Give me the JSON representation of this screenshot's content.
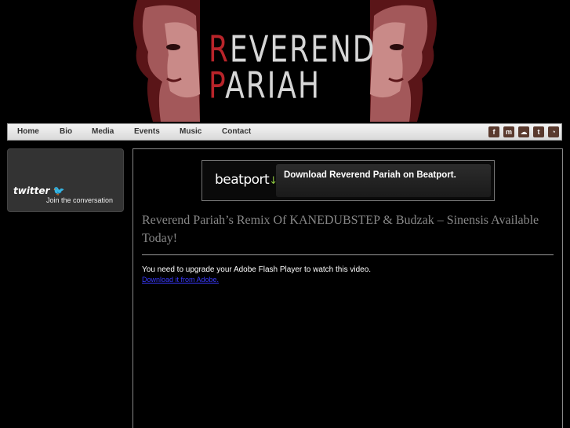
{
  "header": {
    "logo_line1_initial": "R",
    "logo_line1_rest": "EVEREND",
    "logo_line2_initial": "P",
    "logo_line2_rest": "ARIAH"
  },
  "nav": {
    "items": [
      {
        "label": "Home"
      },
      {
        "label": "Bio"
      },
      {
        "label": "Media"
      },
      {
        "label": "Events"
      },
      {
        "label": "Music"
      },
      {
        "label": "Contact"
      }
    ],
    "social": [
      {
        "name": "facebook-icon",
        "glyph": "f"
      },
      {
        "name": "myspace-icon",
        "glyph": "m"
      },
      {
        "name": "soundcloud-icon",
        "glyph": "☁"
      },
      {
        "name": "twitter-icon",
        "glyph": "t"
      },
      {
        "name": "rss-icon",
        "glyph": "◔"
      }
    ]
  },
  "sidebar": {
    "twitter_logo": "twitter",
    "twitter_sub": "Join the conversation"
  },
  "main": {
    "beatport_logo": "beatport",
    "beatport_text": "Download Reverend Pariah on Beatport.",
    "post_title": "Reverend Pariah’s Remix Of KANEDUBSTEP & Budzak – Sinensis Available Today!",
    "flash_message": "You need to upgrade your Adobe Flash Player to watch this video.",
    "flash_link": "Download it from Adobe."
  },
  "colors": {
    "accent_red": "#b8242a",
    "beatport_green": "#8cc63f"
  }
}
